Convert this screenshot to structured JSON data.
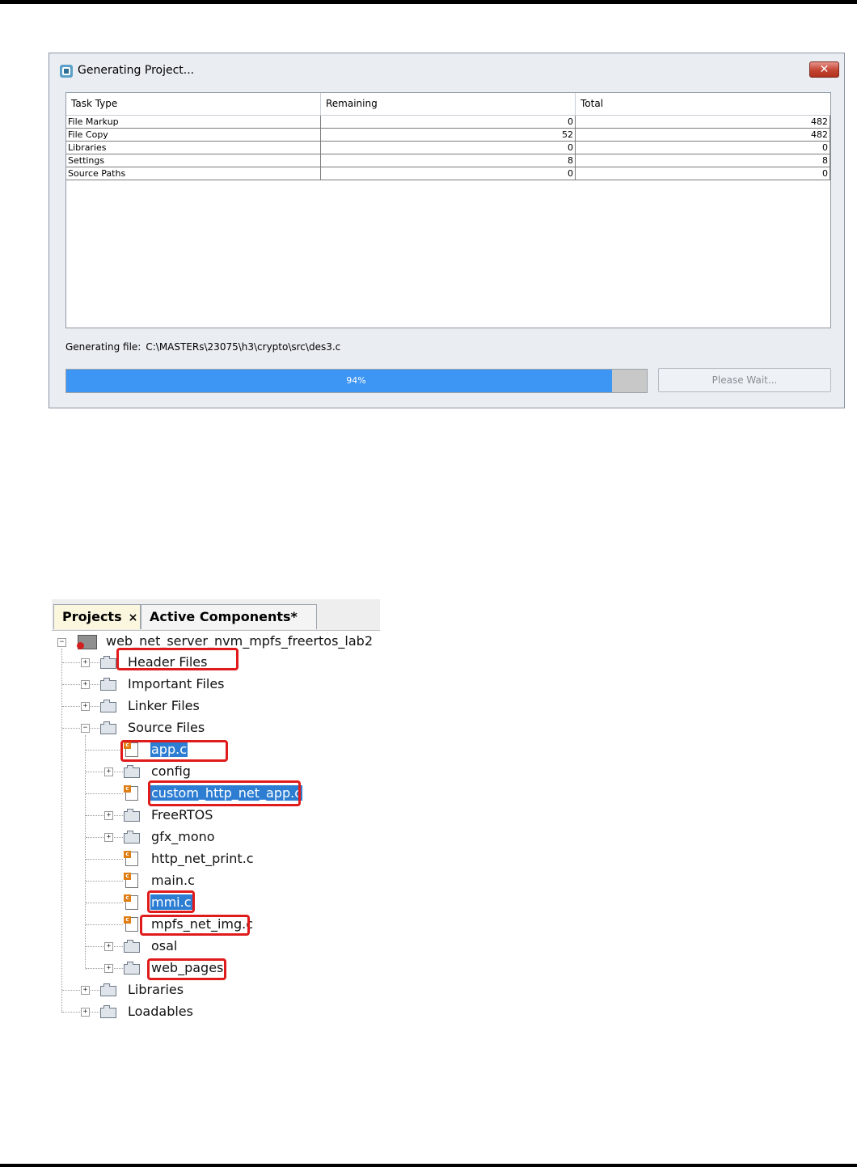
{
  "dialog": {
    "title": "Generating Project...",
    "close_label": "✕",
    "columns": [
      "Task Type",
      "Remaining",
      "Total"
    ],
    "rows": [
      {
        "task": "File Markup",
        "remaining": "0",
        "total": "482"
      },
      {
        "task": "File Copy",
        "remaining": "52",
        "total": "482"
      },
      {
        "task": "Libraries",
        "remaining": "0",
        "total": "0"
      },
      {
        "task": "Settings",
        "remaining": "8",
        "total": "8"
      },
      {
        "task": "Source Paths",
        "remaining": "0",
        "total": "0"
      }
    ],
    "status_label": "Generating file:",
    "status_path": "C:\\MASTERs\\23075\\h3\\crypto\\src\\des3.c",
    "progress": {
      "percent": 94,
      "label": "94%"
    },
    "wait_button": "Please Wait..."
  },
  "tree": {
    "tabs": {
      "projects": "Projects",
      "projects_close": "×",
      "active_components": "Active Components*"
    },
    "project_name": "web_net_server_nvm_mpfs_freertos_lab2",
    "items": [
      {
        "label": "Header Files"
      },
      {
        "label": "Important Files"
      },
      {
        "label": "Linker Files"
      },
      {
        "label": "Source Files"
      },
      {
        "label": "app.c"
      },
      {
        "label": "config"
      },
      {
        "label": "custom_http_net_app.c"
      },
      {
        "label": "FreeRTOS"
      },
      {
        "label": "gfx_mono"
      },
      {
        "label": "http_net_print.c"
      },
      {
        "label": "main.c"
      },
      {
        "label": "mmi.c"
      },
      {
        "label": "mpfs_net_img.c"
      },
      {
        "label": "osal"
      },
      {
        "label": "web_pages"
      },
      {
        "label": "Libraries"
      },
      {
        "label": "Loadables"
      }
    ]
  },
  "colors": {
    "progress_fill": "#3d95f4",
    "selection": "#2d7ed3",
    "highlight": "#e01b1b"
  }
}
